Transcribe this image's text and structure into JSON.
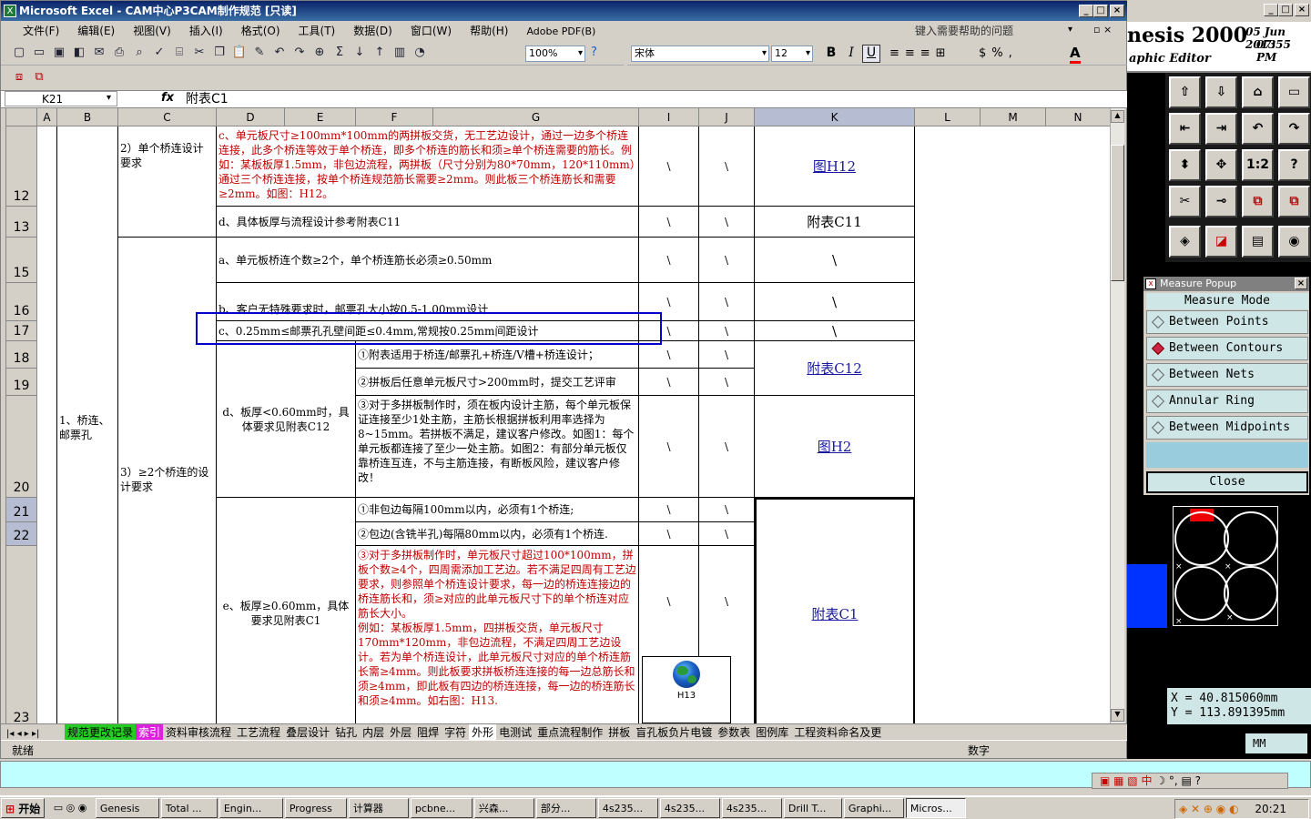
{
  "window": {
    "title": "Microsoft Excel - CAM中心P3CAM制作规范 [只读]",
    "logo": "X"
  },
  "menu": [
    "文件(F)",
    "编辑(E)",
    "视图(V)",
    "插入(I)",
    "格式(O)",
    "工具(T)",
    "数据(D)",
    "窗口(W)",
    "帮助(H)",
    "Adobe PDF(B)"
  ],
  "help_placeholder": "键入需要帮助的问题",
  "toolbar": {
    "zoom": "100%",
    "font": "宋体",
    "size": "12",
    "bold": "B",
    "italic": "I",
    "underline": "U"
  },
  "namebox": "K21",
  "fx": "fx",
  "formula": "附表C1",
  "columns": [
    "A",
    "B",
    "C",
    "D",
    "E",
    "F",
    "G",
    "I",
    "J",
    "K",
    "L",
    "M",
    "N"
  ],
  "rows": [
    "12",
    "13",
    "15",
    "16",
    "17",
    "18",
    "19",
    "20",
    "21",
    "22",
    "23"
  ],
  "cells": {
    "b_main": "1、桥连、邮票孔",
    "c2": "2）单个桥连设计要求",
    "c3": "3）≥2个桥连的设计要求",
    "r12_text": "c、单元板尺寸≥100mm*100mm的两拼板交货，无工艺边设计，通过一边多个桥连连接，此多个桥连等效于单个桥连，即多个桥连的筋长和须≥单个桥连需要的筋长。例如：某板板厚1.5mm，非包边流程，两拼板（尺寸分别为80*70mm，120*110mm）通过三个桥连连接，按单个桥连规范筋长需要≥2mm。则此板三个桥连筋长和需要≥2mm。如图：H12。",
    "r12_k": "图H12",
    "r13_text": "d、具体板厚与流程设计参考附表C11",
    "r13_k": "附表C11",
    "r15_text": "a、单元板桥连个数≥2个，单个桥连筋长必须≥0.50mm",
    "r16_text": "b、客户无特殊要求时，邮票孔大小按0.5-1.00mm设计",
    "r17_text": "c、0.25mm≤邮票孔孔壁间距≤0.4mm,常规按0.25mm间距设计",
    "d_label": "d、板厚<0.60mm时，具体要求见附表C12",
    "r18_text": "①附表适用于桥连/邮票孔+桥连/V槽+桥连设计；",
    "r19_text": "②拼板后任意单元板尺寸>200mm时，提交工艺评审",
    "r18_k": "附表C12",
    "r20_text": "③对于多拼板制作时，须在板内设计主筋，每个单元板保证连接至少1处主筋，主筋长根据拼板利用率选择为8~15mm。若拼板不满足，建议客户修改。如图1：每个单元板都连接了至少一处主筋。如图2：有部分单元板仅靠桥连互连，不与主筋连接，有断板风险，建议客户修改！",
    "r20_k": "图H2",
    "e_label": "e、板厚≥0.60mm，具体要求见附表C1",
    "r21_text": "①非包边每隔100mm以内，必须有1个桥连;",
    "r22_text": "②包边(含铣半孔)每隔80mm以内，必须有1个桥连.",
    "r23_text": "③对于多拼板制作时，单元板尺寸超过100*100mm，拼板个数≥4个，四周需添加工艺边。若不满足四周有工艺边要求，则参照单个桥连设计要求，每一边的桥连连接边的桥连筋长和，须≥对应的此单元板尺寸下的单个桥连对应筋长大小。\n例如：某板板厚1.5mm，四拼板交货，单元板尺寸170mm*120mm，非包边流程，不满足四周工艺边设计。若为单个桥连设计，此单元板尺寸对应的单个桥连筋长需≥4mm。则此板要求拼板桥连连接的每一边总筋长和须≥4mm，即此板有四边的桥连连接，每一边的桥连筋长和须≥4mm。如右图：H13.",
    "r21_k": "附表C1",
    "slash": "\\",
    "globe_label": "H13"
  },
  "sheet_tabs": [
    "规范更改记录",
    "索引",
    "资料审核流程",
    "工艺流程",
    "叠层设计",
    "钻孔",
    "内层",
    "外层",
    "阻焊",
    "字符",
    "外形",
    "电测试",
    "重点流程制作",
    "拼板",
    "盲孔板负片电镀",
    "参数表",
    "图例库",
    "工程资料命名及更"
  ],
  "status": {
    "left": "就绪",
    "right": "数字"
  },
  "genesis": {
    "title": "nesis 2000",
    "subtitle": "aphic Editor",
    "date": "05 Jun 2013",
    "time": "07:55 PM",
    "buttons": [
      "⇧",
      "⇩",
      "⌂",
      "▭",
      "⇤",
      "⇥",
      "↶",
      "↷",
      "⬍",
      "✥",
      "1:2",
      "?",
      "✂",
      "⊸",
      "⧉",
      "⧉",
      "◈",
      "◪",
      "▤",
      "◉"
    ],
    "measure_popup": {
      "title": "Measure Popup",
      "mode": "Measure Mode",
      "options": [
        "Between Points",
        "Between Contours",
        "Between Nets",
        "Annular Ring",
        "Between Midpoints"
      ],
      "selected": 1,
      "close": "Close"
    },
    "coords": {
      "x": "X  =  40.815060mm",
      "y": "Y  =  113.891395mm"
    },
    "unit": "MM"
  },
  "taskbar": {
    "start": "开始",
    "items": [
      "Genesis",
      "Total ...",
      "Engin...",
      "Progress",
      "计算器",
      "pcbne...",
      "兴森...",
      "部分...",
      "4s235...",
      "4s235...",
      "4s235...",
      "Drill T...",
      "Graphi...",
      "Micros..."
    ],
    "clock": "20:21",
    "ime": "中"
  }
}
